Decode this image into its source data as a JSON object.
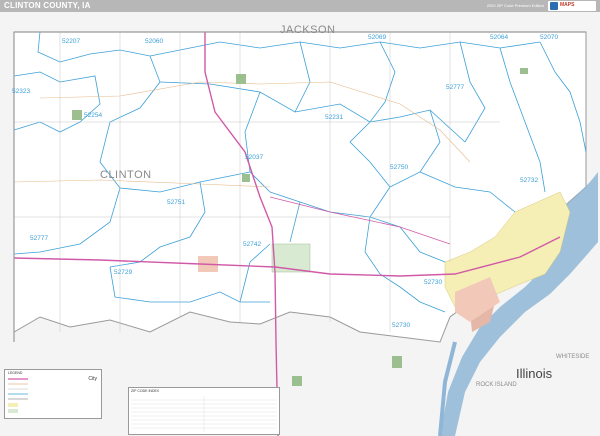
{
  "header": {
    "title": "CLINTON COUNTY, IA",
    "edition": "2020 ZIP Code Premium Edition"
  },
  "map": {
    "counties": {
      "jackson": "JACKSON",
      "clinton": "CLINTON",
      "whiteside": "WHITESIDE",
      "rock_island": "ROCK ISLAND"
    },
    "state": "Illinois",
    "zips": [
      "52207",
      "52060",
      "52069",
      "52064",
      "52070",
      "52323",
      "52254",
      "52777",
      "52231",
      "52037",
      "52750",
      "52732",
      "52751",
      "52777",
      "52742",
      "52729",
      "52730",
      "52730"
    ]
  },
  "legend": {
    "title": "LEGEND",
    "city_label": "City"
  },
  "zip_index": {
    "title": "ZIP CODE INDEX"
  },
  "colors": {
    "zip_boundary": "#3ca0d8",
    "highway": "#d15aa8",
    "river": "#7aa6c9",
    "urban": "#f5efb6",
    "background": "#ffffff",
    "outside_county": "#f2f2f2"
  }
}
